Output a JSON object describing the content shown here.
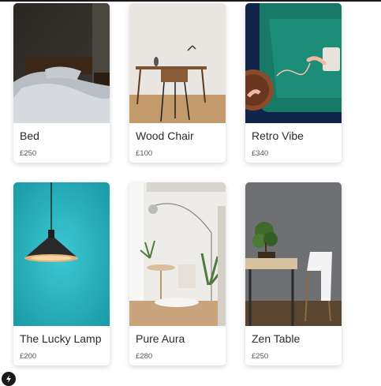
{
  "products": [
    {
      "name": "Bed",
      "price": "£250",
      "image": "bed-photo"
    },
    {
      "name": "Wood Chair",
      "price": "£100",
      "image": "wood-chair-photo"
    },
    {
      "name": "Retro Vibe",
      "price": "£340",
      "image": "retro-phone-photo"
    },
    {
      "name": "The Lucky Lamp",
      "price": "£200",
      "image": "pendant-lamp-photo"
    },
    {
      "name": "Pure Aura",
      "price": "£280",
      "image": "bright-room-photo"
    },
    {
      "name": "Zen Table",
      "price": "£250",
      "image": "bonsai-table-photo"
    }
  ],
  "badge": {
    "icon": "bolt-icon"
  }
}
